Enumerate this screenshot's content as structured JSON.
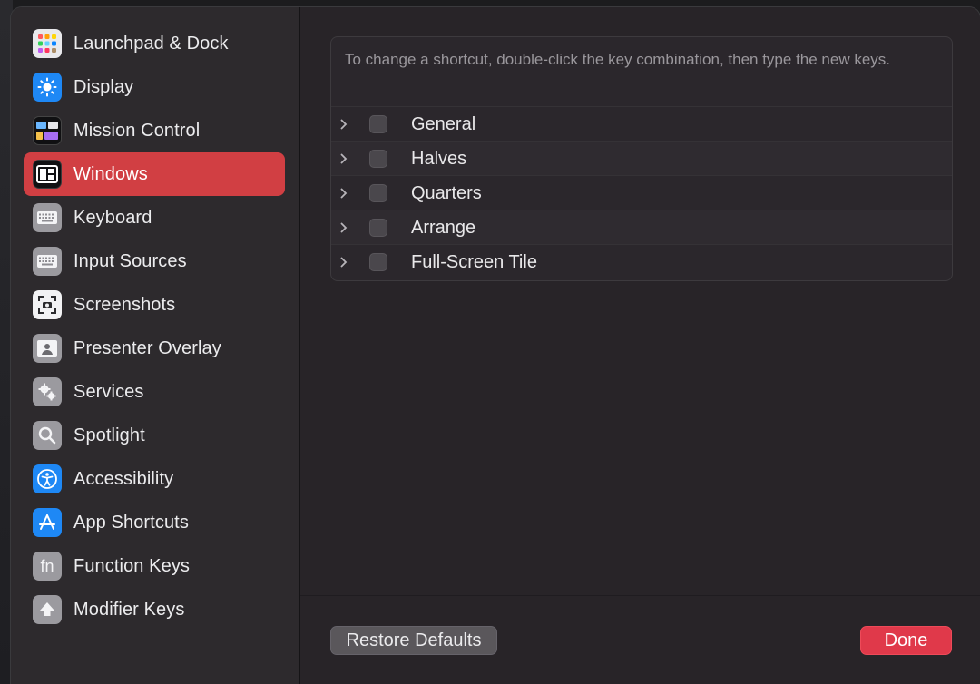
{
  "sidebar": {
    "items": [
      {
        "label": "Launchpad & Dock",
        "icon": "launchpad-icon"
      },
      {
        "label": "Display",
        "icon": "display-brightness-icon"
      },
      {
        "label": "Mission Control",
        "icon": "mission-control-icon"
      },
      {
        "label": "Windows",
        "icon": "windows-icon",
        "selected": true
      },
      {
        "label": "Keyboard",
        "icon": "keyboard-icon"
      },
      {
        "label": "Input Sources",
        "icon": "input-sources-icon"
      },
      {
        "label": "Screenshots",
        "icon": "screenshot-icon"
      },
      {
        "label": "Presenter Overlay",
        "icon": "presenter-overlay-icon"
      },
      {
        "label": "Services",
        "icon": "services-gears-icon"
      },
      {
        "label": "Spotlight",
        "icon": "spotlight-search-icon"
      },
      {
        "label": "Accessibility",
        "icon": "accessibility-icon"
      },
      {
        "label": "App Shortcuts",
        "icon": "app-store-icon"
      },
      {
        "label": "Function Keys",
        "icon": "fn-key-icon",
        "icon_text": "fn"
      },
      {
        "label": "Modifier Keys",
        "icon": "modifier-arrow-up-icon"
      }
    ]
  },
  "main": {
    "hint": "To change a shortcut, double-click the key combination, then type the new keys.",
    "groups": [
      {
        "label": "General",
        "checked": false
      },
      {
        "label": "Halves",
        "checked": false
      },
      {
        "label": "Quarters",
        "checked": false
      },
      {
        "label": "Arrange",
        "checked": false
      },
      {
        "label": "Full-Screen Tile",
        "checked": false
      }
    ]
  },
  "footer": {
    "restore_label": "Restore Defaults",
    "done_label": "Done"
  },
  "colors": {
    "selected": "#d13f43",
    "done": "#e0394a"
  }
}
